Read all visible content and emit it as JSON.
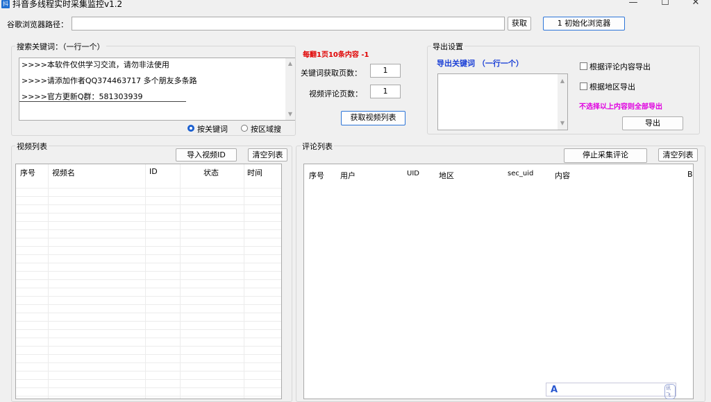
{
  "window": {
    "title": "抖音多线程实时采集监控v1.2",
    "icon": "app-icon",
    "minimize": "—",
    "maximize": "☐",
    "close": "✕"
  },
  "browser_path": {
    "label": "谷歌浏览器路径：",
    "value": "",
    "get_button": "获取",
    "init_button": "1 初始化浏览器"
  },
  "search": {
    "group_title": "搜索关键词：（一行一个）",
    "lines": [
      ">>>>本软件仅供学习交流，请勿非法使用",
      ">>>>请添加作者QQ374463717 多个朋友多条路",
      ">>>>官方更新Q群：581303939"
    ],
    "radio_keyword": "按关键词",
    "radio_region": "按区域搜"
  },
  "fetch": {
    "notice": "每翻1页10条内容 -1",
    "pages_label": "关键词获取页数：",
    "pages_value": "1",
    "comment_pages_label": "视频评论页数：",
    "comment_pages_value": "1",
    "get_list_button": "获取视频列表"
  },
  "export": {
    "group_title": "导出设置",
    "keyword_label": "导出关键词  （一行一个）",
    "by_comment": "根据评论内容导出",
    "by_region": "根据地区导出",
    "hint": "不选择以上内容则全部导出",
    "export_button": "导出"
  },
  "video_list": {
    "group_title": "视频列表",
    "import_button": "导入视频ID",
    "clear_button": "清空列表",
    "columns": [
      "序号",
      "视频名",
      "ID",
      "状态",
      "时间"
    ]
  },
  "comment_list": {
    "group_title": "评论列表",
    "stop_button": "停止采集评论",
    "clear_button": "清空列表",
    "columns": [
      "序号",
      "用户",
      "UID",
      "地区",
      "sec_uid",
      "内容",
      "B"
    ]
  },
  "ime": {
    "text": "A",
    "badge": "讯飞"
  },
  "colors": {
    "accent_blue": "#1a3fd6",
    "notice_red": "#e00000",
    "hint_magenta": "#e000e0"
  }
}
